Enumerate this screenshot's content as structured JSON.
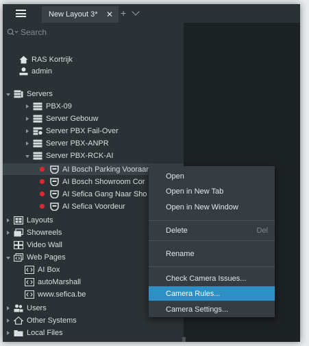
{
  "tab": {
    "title": "New Layout 3*",
    "close": "✕"
  },
  "toolbar": {
    "add": "+"
  },
  "search": {
    "placeholder": "Search"
  },
  "header": {
    "site": "RAS Kortrijk",
    "user": "admin"
  },
  "tree": {
    "servers": "Servers",
    "server_items": [
      "PBX-09",
      "Server Gebouw",
      "Server PBX Fail-Over",
      "Server PBX-ANPR",
      "Server PBX-RCK-AI"
    ],
    "cameras": [
      "AI Bosch Parking Vooraan",
      "AI Bosch Showroom Cor",
      "AI Sefica Gang Naar Sho",
      "AI Sefica Voordeur"
    ],
    "layouts": "Layouts",
    "showreels": "Showreels",
    "video_wall": "Video Wall",
    "web_pages": "Web Pages",
    "web_items": [
      "AI Box",
      "autoMarshall",
      "www.sefica.be"
    ],
    "users": "Users",
    "other_systems": "Other Systems",
    "local_files": "Local Files"
  },
  "context_menu": {
    "open": "Open",
    "open_new_tab": "Open in New Tab",
    "open_new_window": "Open in New Window",
    "delete": "Delete",
    "delete_shortcut": "Del",
    "rename": "Rename",
    "check_camera_issues": "Check Camera Issues...",
    "camera_rules": "Camera Rules...",
    "camera_settings": "Camera Settings..."
  },
  "colors": {
    "highlight": "#2d8fc3",
    "status_dot": "#e0272e",
    "panel": "#2b3134"
  }
}
